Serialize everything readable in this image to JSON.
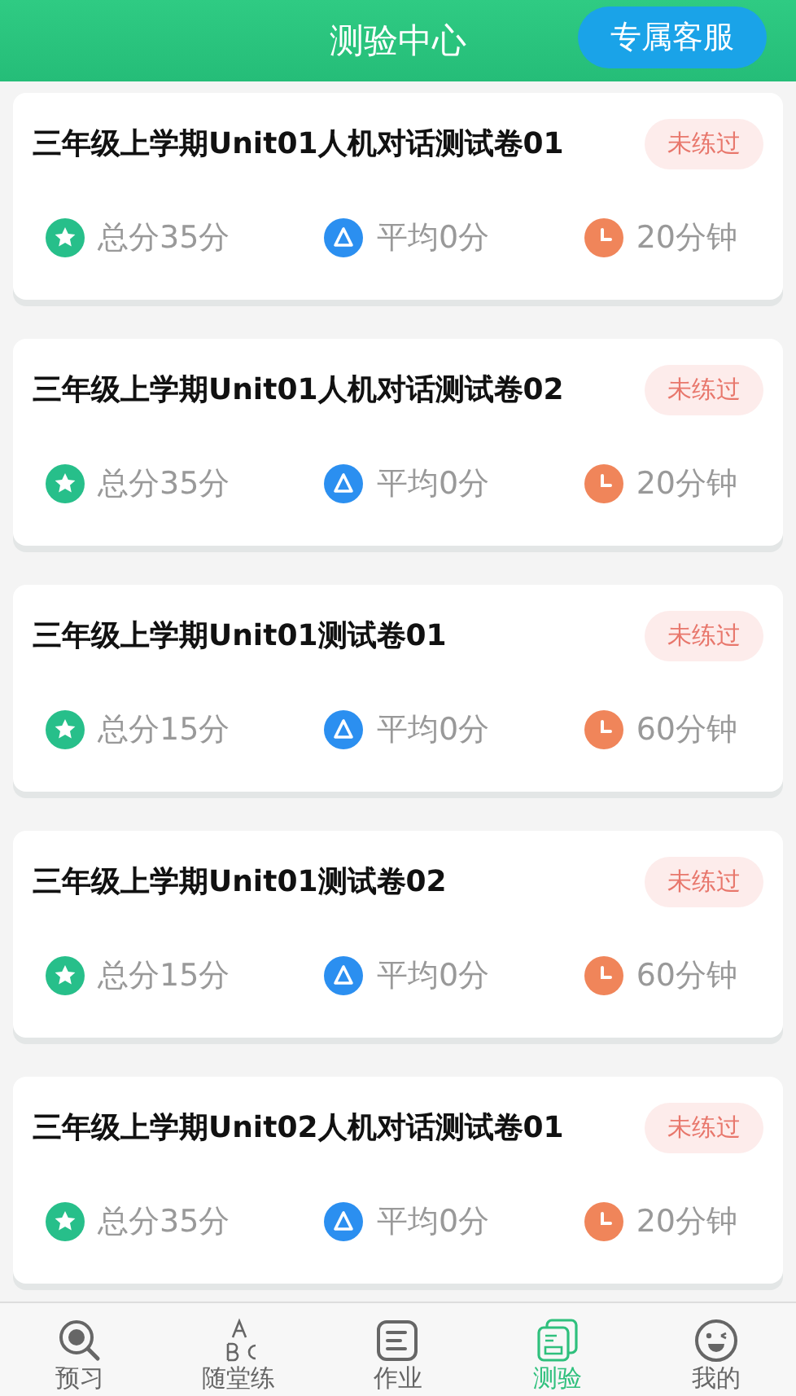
{
  "header": {
    "title": "测验中心",
    "service_button": "专属客服"
  },
  "tests": [
    {
      "title": "三年级上学期Unit01人机对话测试卷01",
      "status": "未练过",
      "total": "总分35分",
      "average": "平均0分",
      "duration": "20分钟"
    },
    {
      "title": "三年级上学期Unit01人机对话测试卷02",
      "status": "未练过",
      "total": "总分35分",
      "average": "平均0分",
      "duration": "20分钟"
    },
    {
      "title": "三年级上学期Unit01测试卷01",
      "status": "未练过",
      "total": "总分15分",
      "average": "平均0分",
      "duration": "60分钟"
    },
    {
      "title": "三年级上学期Unit01测试卷02",
      "status": "未练过",
      "total": "总分15分",
      "average": "平均0分",
      "duration": "60分钟"
    },
    {
      "title": "三年级上学期Unit02人机对话测试卷01",
      "status": "未练过",
      "total": "总分35分",
      "average": "平均0分",
      "duration": "20分钟"
    }
  ],
  "tab_bar": [
    {
      "label": "预习",
      "kind": "search",
      "selected": false
    },
    {
      "label": "随堂练",
      "kind": "abc",
      "selected": false
    },
    {
      "label": "作业",
      "kind": "doc",
      "selected": false
    },
    {
      "label": "测验",
      "kind": "test",
      "selected": true
    },
    {
      "label": "我的",
      "kind": "face",
      "selected": false
    }
  ]
}
